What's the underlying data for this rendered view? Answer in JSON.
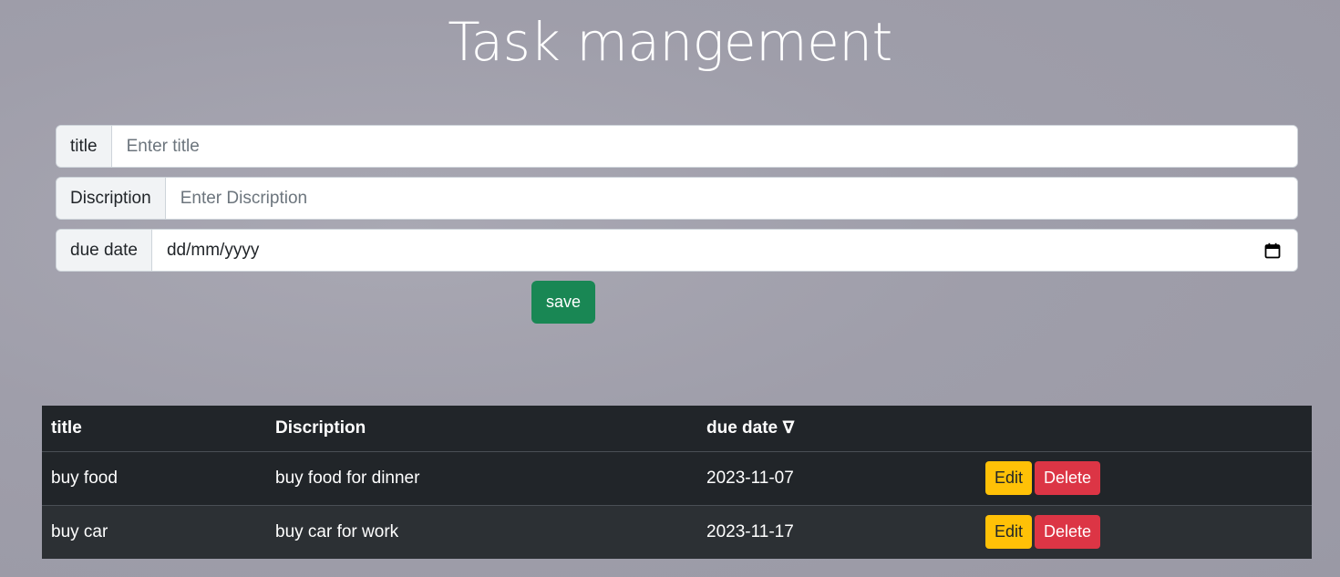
{
  "header": {
    "title": "Task mangement"
  },
  "form": {
    "title_label": "title",
    "title_placeholder": "Enter title",
    "description_label": "Discription",
    "description_placeholder": "Enter Discription",
    "due_date_label": "due date",
    "due_date_placeholder": "dd/mm/yyyy",
    "save_label": "save"
  },
  "table": {
    "headers": {
      "title": "title",
      "description": "Discription",
      "due_date": "due date ∇",
      "actions": ""
    },
    "rows": [
      {
        "title": "buy food",
        "description": "buy food for dinner",
        "due_date": "2023-11-07",
        "edit_label": "Edit",
        "delete_label": "Delete"
      },
      {
        "title": "buy car",
        "description": "buy car for work",
        "due_date": "2023-11-17",
        "edit_label": "Edit",
        "delete_label": "Delete"
      }
    ]
  },
  "colors": {
    "save": "#198754",
    "edit": "#ffc107",
    "delete": "#dc3545",
    "table_bg": "#212529"
  },
  "icons": {
    "date_picker": "calendar-icon"
  }
}
